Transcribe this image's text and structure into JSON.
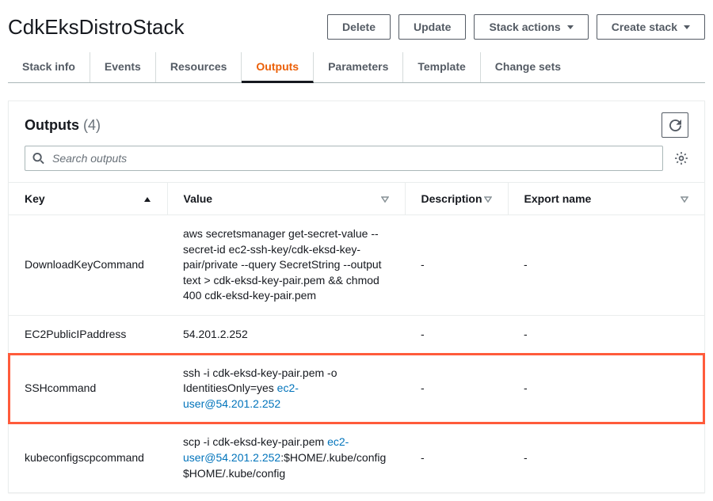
{
  "header": {
    "title": "CdkEksDistroStack",
    "buttons": {
      "delete": "Delete",
      "update": "Update",
      "stack_actions": "Stack actions",
      "create_stack": "Create stack"
    }
  },
  "tabs": [
    {
      "id": "stack-info",
      "label": "Stack info",
      "active": false
    },
    {
      "id": "events",
      "label": "Events",
      "active": false
    },
    {
      "id": "resources",
      "label": "Resources",
      "active": false
    },
    {
      "id": "outputs",
      "label": "Outputs",
      "active": true
    },
    {
      "id": "parameters",
      "label": "Parameters",
      "active": false
    },
    {
      "id": "template",
      "label": "Template",
      "active": false
    },
    {
      "id": "change-sets",
      "label": "Change sets",
      "active": false
    }
  ],
  "panel": {
    "title": "Outputs",
    "count": "(4)",
    "search_placeholder": "Search outputs"
  },
  "columns": {
    "key": "Key",
    "value": "Value",
    "description": "Description",
    "export_name": "Export name"
  },
  "rows": [
    {
      "key": "DownloadKeyCommand",
      "value_pre": "aws secretsmanager get-secret-value --secret-id ec2-ssh-key/cdk-eksd-key-pair/private --query SecretString --output text > cdk-eksd-key-pair.pem && chmod 400 cdk-eksd-key-pair.pem",
      "value_link": "",
      "value_post": "",
      "description": "-",
      "export_name": "-",
      "highlight": false
    },
    {
      "key": "EC2PublicIPaddress",
      "value_pre": "54.201.2.252",
      "value_link": "",
      "value_post": "",
      "description": "-",
      "export_name": "-",
      "highlight": false
    },
    {
      "key": "SSHcommand",
      "value_pre": "ssh -i cdk-eksd-key-pair.pem -o IdentitiesOnly=yes ",
      "value_link": "ec2-user@54.201.2.252",
      "value_post": "",
      "description": "-",
      "export_name": "-",
      "highlight": true
    },
    {
      "key": "kubeconfigscpcommand",
      "value_pre": "scp -i cdk-eksd-key-pair.pem ",
      "value_link": "ec2-user@54.201.2.252",
      "value_post": ":$HOME/.kube/config $HOME/.kube/config",
      "description": "-",
      "export_name": "-",
      "highlight": false
    }
  ]
}
